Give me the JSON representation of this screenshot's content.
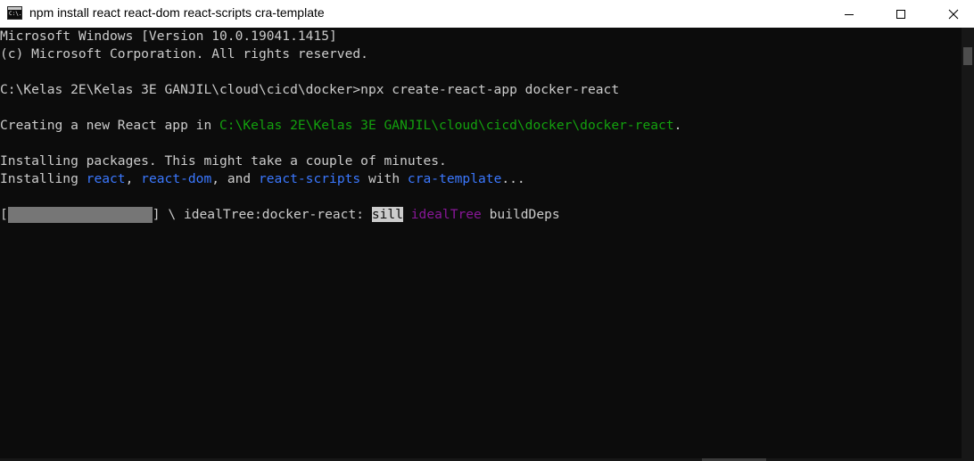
{
  "window": {
    "title": "npm install react react-dom react-scripts cra-template",
    "icon_text": "C:\\."
  },
  "controls": {
    "minimize_icon": "minimize-icon",
    "maximize_icon": "maximize-icon",
    "close_icon": "close-icon"
  },
  "console": {
    "line1": "Microsoft Windows [Version 10.0.19041.1415]",
    "line2": "(c) Microsoft Corporation. All rights reserved.",
    "prompt": "C:\\Kelas 2E\\Kelas 3E GANJIL\\cloud\\cicd\\docker>npx create-react-app docker-react",
    "creating_prefix": "Creating a new React app in ",
    "creating_path": "C:\\Kelas 2E\\Kelas 3E GANJIL\\cloud\\cicd\\docker\\docker-react",
    "creating_suffix": ".",
    "installing_msg": "Installing packages. This might take a couple of minutes.",
    "install_prefix": "Installing ",
    "pkg_react": "react",
    "sep1": ", ",
    "pkg_react_dom": "react-dom",
    "sep2": ", and ",
    "pkg_react_scripts": "react-scripts",
    "with_text": " with ",
    "pkg_cra_template": "cra-template",
    "ellipsis": "...",
    "progress_open": "[",
    "progress_close": "] \\ idealTree:docker-react: ",
    "progress_level": "sill",
    "progress_stage": "idealTree",
    "progress_task": " buildDeps"
  },
  "colors": {
    "background": "#0c0c0c",
    "text": "#cccccc",
    "path_green": "#13a10e",
    "package_blue": "#3b78ff",
    "stage_magenta": "#881798"
  }
}
